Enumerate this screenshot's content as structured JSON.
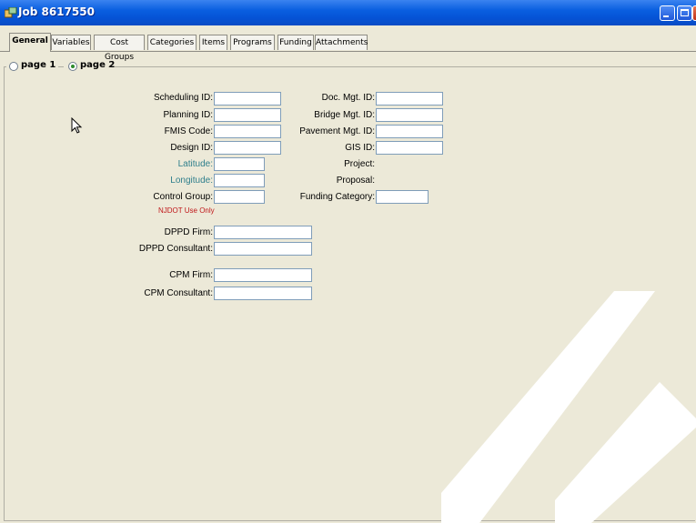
{
  "window": {
    "title": "Job 8617550"
  },
  "tabs": [
    {
      "label": "General",
      "active": true
    },
    {
      "label": "Variables",
      "active": false
    },
    {
      "label": "Cost Groups",
      "active": false
    },
    {
      "label": "Categories",
      "active": false
    },
    {
      "label": "Items",
      "active": false
    },
    {
      "label": "Programs",
      "active": false
    },
    {
      "label": "Funding",
      "active": false
    },
    {
      "label": "Attachments",
      "active": false
    }
  ],
  "pages": [
    {
      "label": "page 1",
      "selected": false
    },
    {
      "label": "page 2",
      "selected": true
    }
  ],
  "form": {
    "left": [
      {
        "label": "Scheduling ID:",
        "value": ""
      },
      {
        "label": "Planning ID:",
        "value": ""
      },
      {
        "label": "FMIS Code:",
        "value": ""
      },
      {
        "label": "Design ID:",
        "value": ""
      },
      {
        "label": "Latitude:",
        "value": ""
      },
      {
        "label": "Longitude:",
        "value": ""
      },
      {
        "label": "Control Group:",
        "value": ""
      }
    ],
    "control_group_note": "NJDOT Use Only",
    "right": [
      {
        "label": "Doc. Mgt. ID:",
        "value": ""
      },
      {
        "label": "Bridge Mgt. ID:",
        "value": ""
      },
      {
        "label": "Pavement Mgt. ID:",
        "value": ""
      },
      {
        "label": "GIS ID:",
        "value": ""
      },
      {
        "label": "Project:",
        "value": ""
      },
      {
        "label": "Proposal:",
        "value": ""
      },
      {
        "label": "Funding Category:",
        "value": ""
      }
    ],
    "dppd": [
      {
        "label": "DPPD Firm:",
        "value": ""
      },
      {
        "label": "DPPD Consultant:",
        "value": ""
      }
    ],
    "cpm": [
      {
        "label": "CPM Firm:",
        "value": ""
      },
      {
        "label": "CPM Consultant:",
        "value": ""
      }
    ]
  },
  "colors": {
    "titlebar": "#0553d6",
    "panel": "#ece9d8",
    "geo_label": "#2f7f8c",
    "note": "#c0171a"
  }
}
